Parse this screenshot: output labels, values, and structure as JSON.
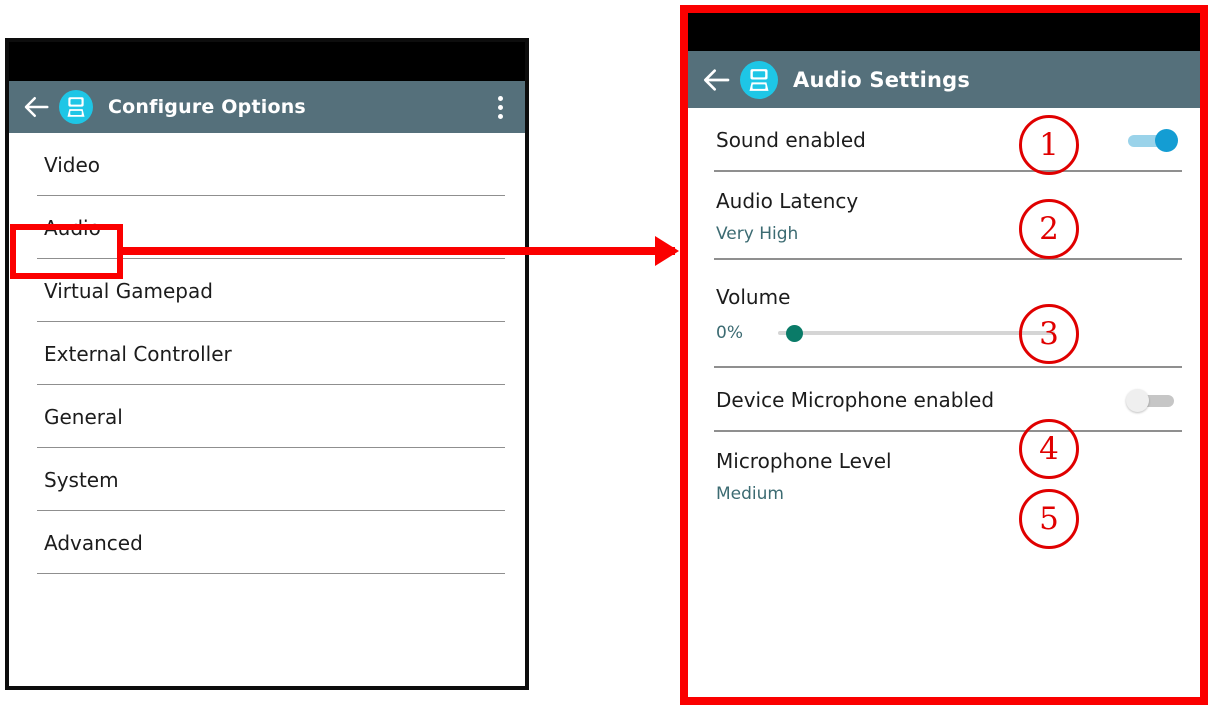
{
  "colors": {
    "appbar": "#55707b",
    "statusbar": "#000000",
    "accent_icon": "#1ec6e6",
    "switch_on_thumb": "#149dd3",
    "switch_on_track": "#9ad3ea",
    "switch_off_thumb": "#efefef",
    "slider_thumb": "#0a7b68",
    "summary_text": "#3c6b72",
    "callout_red": "#e00000",
    "highlight_red": "#fb0000"
  },
  "left_panel": {
    "appbar": {
      "back_icon": "back-arrow-icon",
      "app_icon": "dual-screen-device-icon",
      "title": "Configure Options",
      "overflow_icon": "more-vertical-icon"
    },
    "menu_items": [
      {
        "label": "Video"
      },
      {
        "label": "Audio"
      },
      {
        "label": "Virtual Gamepad"
      },
      {
        "label": "External Controller"
      },
      {
        "label": "General"
      },
      {
        "label": "System"
      },
      {
        "label": "Advanced"
      }
    ],
    "highlighted_item": "Audio"
  },
  "right_panel": {
    "appbar": {
      "back_icon": "back-arrow-icon",
      "app_icon": "dual-screen-device-icon",
      "title": "Audio Settings"
    },
    "preferences": [
      {
        "title": "Sound enabled",
        "summary": "",
        "control": "switch",
        "value": "on"
      },
      {
        "title": "Audio Latency",
        "summary": "Very High",
        "control": "none",
        "value": "Very High"
      },
      {
        "title": "Volume",
        "summary": "",
        "control": "slider",
        "value": "0%"
      },
      {
        "title": "Device Microphone enabled",
        "summary": "",
        "control": "switch",
        "value": "off"
      },
      {
        "title": "Microphone Level",
        "summary": "Medium",
        "control": "none",
        "value": "Medium"
      }
    ]
  },
  "callouts": [
    {
      "number": "①",
      "digit": "1"
    },
    {
      "number": "②",
      "digit": "2"
    },
    {
      "number": "③",
      "digit": "3"
    },
    {
      "number": "④",
      "digit": "4"
    },
    {
      "number": "⑤",
      "digit": "5"
    }
  ]
}
